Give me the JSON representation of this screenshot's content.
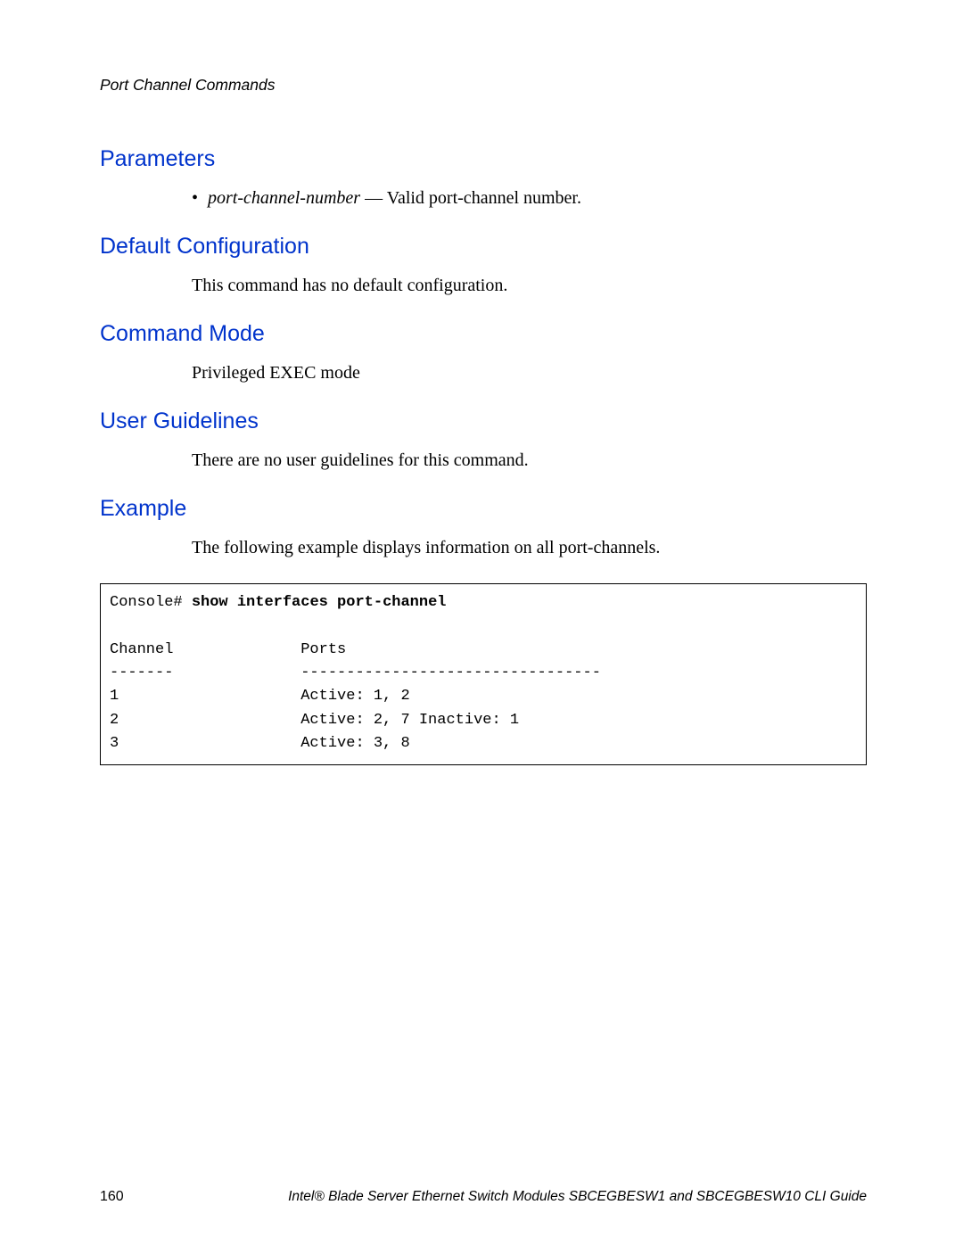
{
  "header": {
    "chapter": "Port Channel Commands"
  },
  "sections": {
    "parameters": {
      "heading": "Parameters",
      "bullet_marker": "•",
      "param_name": "port-channel-number",
      "param_desc": " — Valid port-channel number."
    },
    "default_config": {
      "heading": "Default Configuration",
      "text": "This command has no default configuration."
    },
    "command_mode": {
      "heading": "Command Mode",
      "text": "Privileged EXEC mode"
    },
    "user_guidelines": {
      "heading": "User Guidelines",
      "text": "There are no user guidelines for this command."
    },
    "example": {
      "heading": "Example",
      "intro": "The following example displays information on all port-channels.",
      "code": {
        "prompt": "Console# ",
        "command": "show interfaces port-channel",
        "blank": "",
        "header_row": "Channel              Ports",
        "divider_row": "-------              ---------------------------------",
        "row1": "1                    Active: 1, 2",
        "row2": "2                    Active: 2, 7 Inactive: 1",
        "row3": "3                    Active: 3, 8"
      }
    }
  },
  "footer": {
    "page_number": "160",
    "title": "Intel® Blade Server Ethernet Switch Modules SBCEGBESW1 and SBCEGBESW10 CLI Guide"
  }
}
